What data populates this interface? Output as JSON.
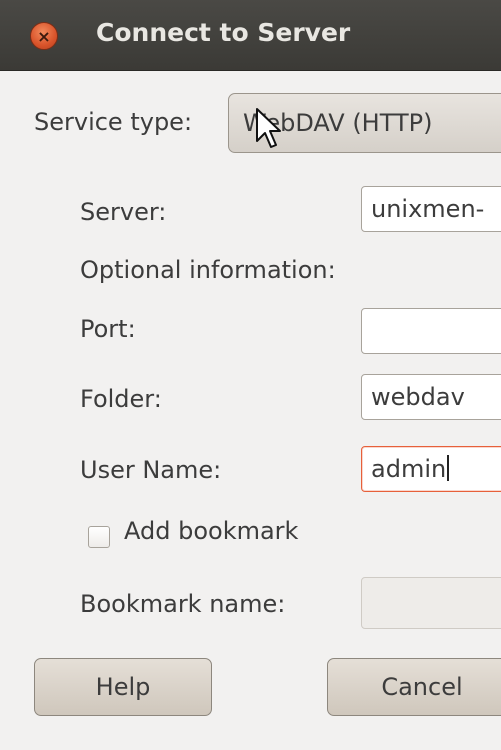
{
  "window": {
    "title": "Connect to Server",
    "close_icon": "close-icon"
  },
  "service": {
    "label": "Service type:",
    "value": "WebDAV (HTTP)"
  },
  "form": {
    "server_label": "Server:",
    "server_value": "unixmen-",
    "optional_label": "Optional information:",
    "port_label": "Port:",
    "port_value": "",
    "folder_label": "Folder:",
    "folder_value": "webdav",
    "username_label": "User Name:",
    "username_value": "admin",
    "bookmark_checkbox_label": "Add bookmark",
    "bookmark_checked": false,
    "bookmark_name_label": "Bookmark name:",
    "bookmark_name_value": ""
  },
  "buttons": {
    "help": "Help",
    "cancel": "Cancel"
  },
  "colors": {
    "titlebar": "#3c3b37",
    "close_button": "#df5a2e",
    "focus_border": "#e7603a"
  }
}
